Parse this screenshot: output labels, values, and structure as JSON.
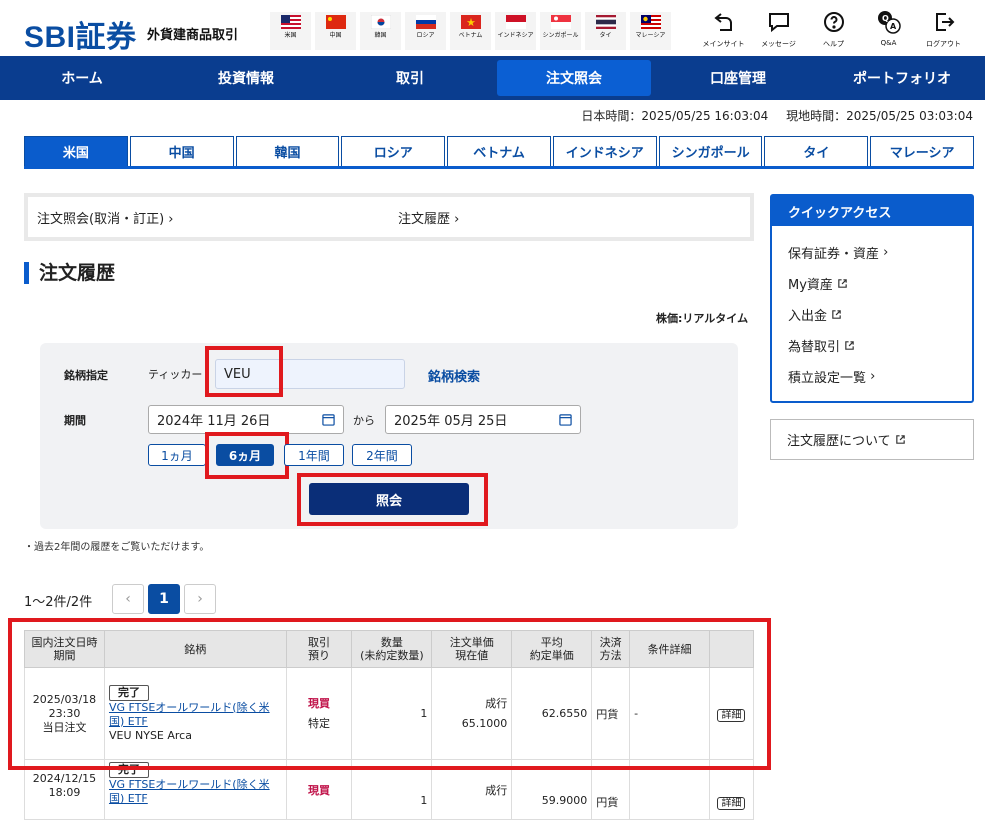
{
  "header": {
    "logo": "SBI証券",
    "subtitle": "外貨建商品取引",
    "flags": [
      {
        "name": "us",
        "label": "米国"
      },
      {
        "name": "cn",
        "label": "中国"
      },
      {
        "name": "kr",
        "label": "韓国"
      },
      {
        "name": "ru",
        "label": "ロシア"
      },
      {
        "name": "vn",
        "label": "ベトナム"
      },
      {
        "name": "id",
        "label": "インドネシア"
      },
      {
        "name": "sg",
        "label": "シンガポール"
      },
      {
        "name": "th",
        "label": "タイ"
      },
      {
        "name": "my",
        "label": "マレーシア"
      }
    ],
    "icons": [
      {
        "icon": "main-site-icon",
        "label": "メインサイト"
      },
      {
        "icon": "message-icon",
        "label": "メッセージ"
      },
      {
        "icon": "help-icon",
        "label": "ヘルプ"
      },
      {
        "icon": "qa-icon",
        "label": "Q&A"
      },
      {
        "icon": "logout-icon",
        "label": "ログアウト"
      }
    ]
  },
  "nav": [
    "ホーム",
    "投資情報",
    "取引",
    "注文照会",
    "口座管理",
    "ポートフォリオ"
  ],
  "time": {
    "japan": "日本時間：2025/05/25 16:03:04",
    "local": "現地時間：2025/05/25 03:03:04"
  },
  "country_tabs": [
    "米国",
    "中国",
    "韓国",
    "ロシア",
    "ベトナム",
    "インドネシア",
    "シンガポール",
    "タイ",
    "マレーシア"
  ],
  "links": {
    "order_inquiry": "注文照会(取消・訂正)",
    "order_history": "注文履歴"
  },
  "page_title": "注文履歴",
  "realtime_note": "株価:リアルタイム",
  "form": {
    "symbol_label": "銘柄指定",
    "ticker_label": "ティッカー",
    "ticker_value": "VEU",
    "symbol_search": "銘柄検索",
    "period_label": "期間",
    "date_from": "2024年 11月 26日",
    "from_to": "から",
    "date_to": "2025年 05月 25日",
    "ranges": [
      "1ヵ月",
      "6ヵ月",
      "1年間",
      "2年間"
    ],
    "submit": "照会"
  },
  "note": "・過去2年間の履歴をご覧いただけます。",
  "pager": {
    "count": "1〜2件/2件",
    "prev": "‹",
    "page": "1",
    "next": "›"
  },
  "quick_access": {
    "title": "クイックアクセス",
    "items": [
      "保有証券・資産",
      "My資産",
      "入出金",
      "為替取引",
      "積立設定一覧"
    ],
    "about": "注文履歴について"
  },
  "table": {
    "headers": [
      [
        "国内注文日時",
        "期間"
      ],
      [
        "銘柄"
      ],
      [
        "取引",
        "預り"
      ],
      [
        "数量",
        "(未約定数量)"
      ],
      [
        "注文単価",
        "現在値"
      ],
      [
        "平均",
        "約定単価"
      ],
      [
        "決済",
        "方法"
      ],
      [
        "条件詳細"
      ],
      [
        ""
      ]
    ],
    "rows": [
      {
        "date": "2025/03/18",
        "time": "23:30",
        "period": "当日注文",
        "status": "完了",
        "name": "VG FTSEオールワールド(除く米国) ETF",
        "market": "VEU NYSE Arca",
        "trade": "現買",
        "custody": "特定",
        "qty": "1",
        "order_type": "成行",
        "price": "65.1000",
        "avg": "62.6550",
        "settle": "円貨",
        "cond": "-",
        "detail": "詳細"
      },
      {
        "date": "2024/12/15",
        "time": "18:09",
        "period": "",
        "status": "完了",
        "name": "VG FTSEオールワールド(除く米国) ETF",
        "market": "",
        "trade": "現買",
        "custody": "",
        "qty": "1",
        "order_type": "成行",
        "price": "",
        "avg": "59.9000",
        "settle": "円貨",
        "cond": "",
        "detail": "詳細"
      }
    ]
  }
}
